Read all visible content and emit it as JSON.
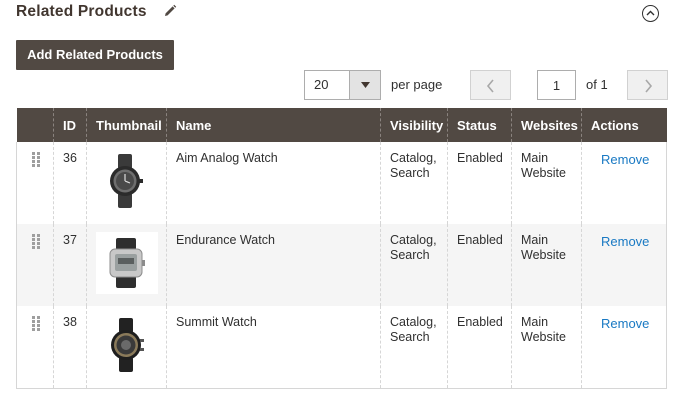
{
  "section": {
    "title": "Related Products"
  },
  "toolbar": {
    "add_button_label": "Add Related Products"
  },
  "pager": {
    "per_page_value": "20",
    "per_page_label": "per page",
    "current_page": "1",
    "total_pages_label": "of 1"
  },
  "grid": {
    "columns": [
      "",
      "ID",
      "Thumbnail",
      "Name",
      "Visibility",
      "Status",
      "Websites",
      "Actions"
    ],
    "rows": [
      {
        "id": "36",
        "thumbnail": "black-analog-watch",
        "name": "Aim Analog Watch",
        "visibility_1": "Catalog,",
        "visibility_2": "Search",
        "status": "Enabled",
        "websites_1": "Main",
        "websites_2": "Website",
        "action": "Remove"
      },
      {
        "id": "37",
        "thumbnail": "silver-digital-watch",
        "name": "Endurance Watch",
        "visibility_1": "Catalog,",
        "visibility_2": "Search",
        "status": "Enabled",
        "websites_1": "Main",
        "websites_2": "Website",
        "action": "Remove"
      },
      {
        "id": "38",
        "thumbnail": "black-sport-watch",
        "name": "Summit Watch",
        "visibility_1": "Catalog,",
        "visibility_2": "Search",
        "status": "Enabled",
        "websites_1": "Main",
        "websites_2": "Website",
        "action": "Remove"
      }
    ]
  },
  "colors": {
    "header_bg": "#514943",
    "link": "#1979c3",
    "alt_row": "#f5f5f5"
  }
}
